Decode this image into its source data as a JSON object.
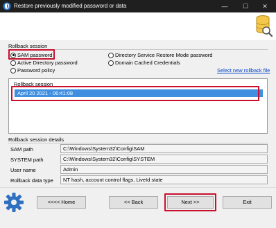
{
  "window": {
    "title": "Restore previously modified password or data",
    "minimize_glyph": "—",
    "maximize_glyph": "☐",
    "close_glyph": "✕"
  },
  "rollback_session": {
    "group_label": "Rollback session",
    "options": [
      {
        "label": "SAM password",
        "selected": true
      },
      {
        "label": "Active Directory password",
        "selected": false
      },
      {
        "label": "Password policy",
        "selected": false
      },
      {
        "label": "Directory Service Restore Mode password",
        "selected": false
      },
      {
        "label": "Domain Cached Credentials",
        "selected": false
      }
    ],
    "select_new_link": "Select new rollback file",
    "list_label": "Rollback session",
    "sessions": [
      "April 20 2021 - 06:41:08"
    ]
  },
  "details": {
    "group_label": "Rollback session details",
    "rows": [
      {
        "label": "SAM path",
        "value": "C:\\Windows\\System32\\Config\\SAM"
      },
      {
        "label": "SYSTEM path",
        "value": "C:\\Windows\\System32\\Config\\SYSTEM"
      },
      {
        "label": "User name",
        "value": "Admin"
      },
      {
        "label": "Rollback data type",
        "value": "NT hash, account control flags, LiveId state"
      }
    ]
  },
  "buttons": {
    "home": "<<<< Home",
    "back": "<< Back",
    "next": "Next >>",
    "exit": "Exit"
  },
  "icons": {
    "app": "app-shield-icon",
    "database": "database-search-icon",
    "settings": "gear-icon"
  },
  "colors": {
    "highlight": "#c8102e",
    "selection": "#3f8ee0",
    "link": "#0645c8",
    "titlebar": "#1f1f1f"
  }
}
